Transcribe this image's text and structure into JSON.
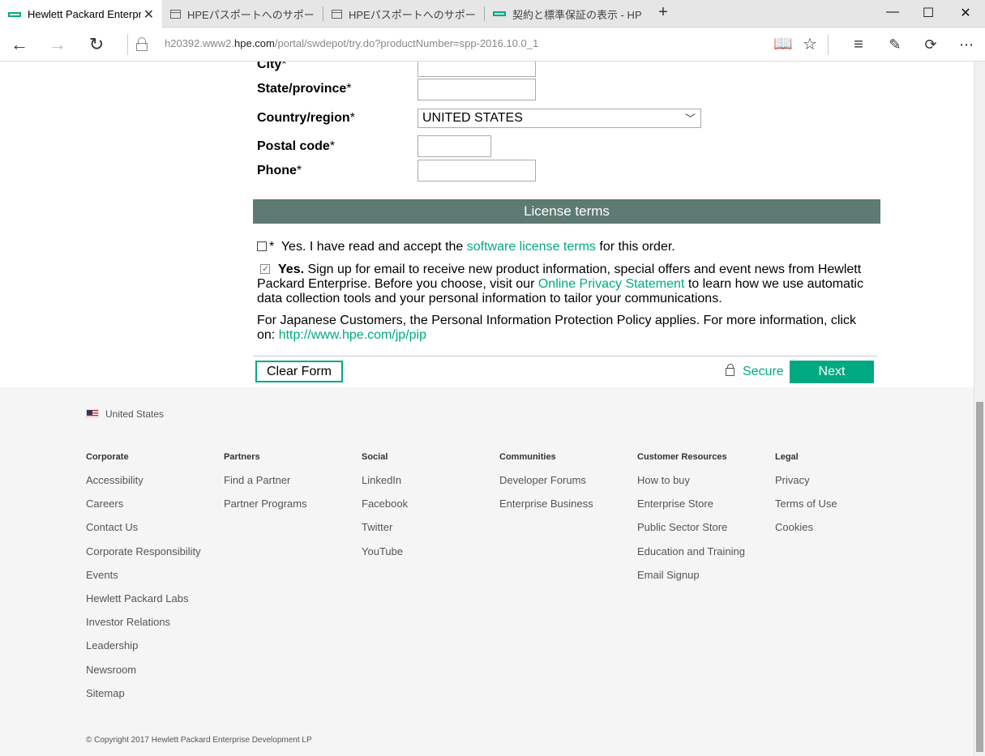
{
  "browser": {
    "tabs": [
      {
        "title": "Hewlett Packard Enterpr",
        "active": true,
        "icon": "hpe-icon"
      },
      {
        "title": "HPEパスポートへのサポートサービ",
        "active": false,
        "icon": "page-icon"
      },
      {
        "title": "HPEパスポートへのサポートサービ",
        "active": false,
        "icon": "page-icon"
      },
      {
        "title": "契約と標準保証の表示 - HPE",
        "active": false,
        "icon": "hpe-icon"
      }
    ],
    "url_prefix": "h20392.www2.",
    "url_domain": "hpe.com",
    "url_suffix": "/portal/swdepot/try.do?productNumber=spp-2016.10.0_1"
  },
  "form": {
    "city_label": "City",
    "state_label": "State/province",
    "country_label": "Country/region",
    "country_value": "UNITED STATES",
    "postal_label": "Postal code",
    "phone_label": "Phone",
    "required_mark": "*"
  },
  "license": {
    "header": "License terms",
    "accept_prefix": "Yes.  I have read and accept the ",
    "accept_link": "software license terms",
    "accept_suffix": " for this order.",
    "email_yes": "Yes.",
    "email_text1": "  Sign up for email to receive new product information, special offers and event news from Hewlett Packard Enterprise.  Before you choose, visit our ",
    "email_link": "Online Privacy Statement",
    "email_text2": " to learn how we use automatic data collection tools and your personal information to tailor your communications.",
    "japan_text": "For Japanese Customers, the Personal Information Protection Policy applies.  For more information, click on: ",
    "japan_link": "http://www.hpe.com/jp/pip",
    "accept_checked": false,
    "email_checked": true
  },
  "actions": {
    "clear_label": "Clear Form",
    "secure_label": "Secure",
    "next_label": "Next"
  },
  "footer": {
    "country": "United States",
    "columns": [
      {
        "heading": "Corporate",
        "items": [
          "Accessibility",
          "Careers",
          "Contact Us",
          "Corporate Responsibility",
          "Events",
          "Hewlett Packard Labs",
          "Investor Relations",
          "Leadership",
          "Newsroom",
          "Sitemap"
        ]
      },
      {
        "heading": "Partners",
        "items": [
          "Find a Partner",
          "Partner Programs"
        ]
      },
      {
        "heading": "Social",
        "items": [
          "LinkedIn",
          "Facebook",
          "Twitter",
          "YouTube"
        ]
      },
      {
        "heading": "Communities",
        "items": [
          "Developer Forums",
          "Enterprise Business"
        ]
      },
      {
        "heading": "Customer Resources",
        "items": [
          "How to buy",
          "Enterprise Store",
          "Public Sector Store",
          "Education and Training",
          "Email Signup"
        ]
      },
      {
        "heading": "Legal",
        "items": [
          "Privacy",
          "Terms of Use",
          "Cookies"
        ]
      }
    ],
    "copyright": "© Copyright 2017 Hewlett Packard Enterprise Development LP"
  },
  "colors": {
    "accent": "#01a982",
    "license_bar": "#5e7a72",
    "footer_bg": "#f5f5f5"
  }
}
